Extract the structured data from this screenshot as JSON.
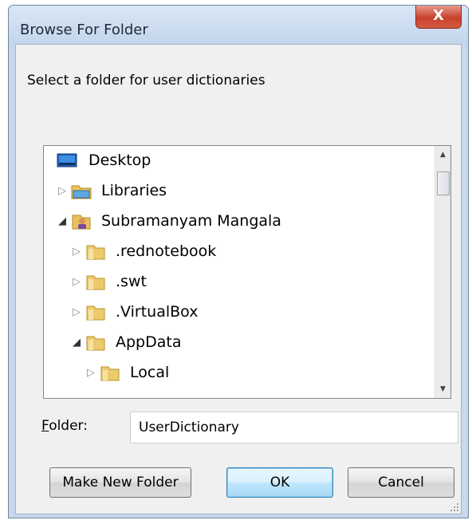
{
  "window": {
    "title": "Browse For Folder",
    "close_label": "X"
  },
  "instruction": "Select a folder for user dictionaries",
  "tree": {
    "items": [
      {
        "label": "Desktop",
        "icon": "desktop-icon",
        "expander": "none"
      },
      {
        "label": "Libraries",
        "icon": "libraries-icon",
        "expander": "collapsed"
      },
      {
        "label": "Subramanyam Mangala",
        "icon": "user-folder-icon",
        "expander": "expanded"
      },
      {
        "label": ".rednotebook",
        "icon": "folder-icon",
        "expander": "collapsed"
      },
      {
        "label": ".swt",
        "icon": "folder-icon",
        "expander": "collapsed"
      },
      {
        "label": ".VirtualBox",
        "icon": "folder-icon",
        "expander": "collapsed"
      },
      {
        "label": "AppData",
        "icon": "folder-icon",
        "expander": "expanded"
      },
      {
        "label": "Local",
        "icon": "folder-icon",
        "expander": "collapsed"
      }
    ],
    "scroll": {
      "up_icon": "scroll-up-icon",
      "down_icon": "scroll-down-icon"
    }
  },
  "folder": {
    "label": "Folder:",
    "value": "UserDictionary"
  },
  "buttons": {
    "make_new_folder": "Make New Folder",
    "ok": "OK",
    "cancel": "Cancel"
  },
  "colors": {
    "close_button": "#c9412c",
    "ok_border": "#3c7fb1",
    "title_bar": "#c9d8ec"
  }
}
